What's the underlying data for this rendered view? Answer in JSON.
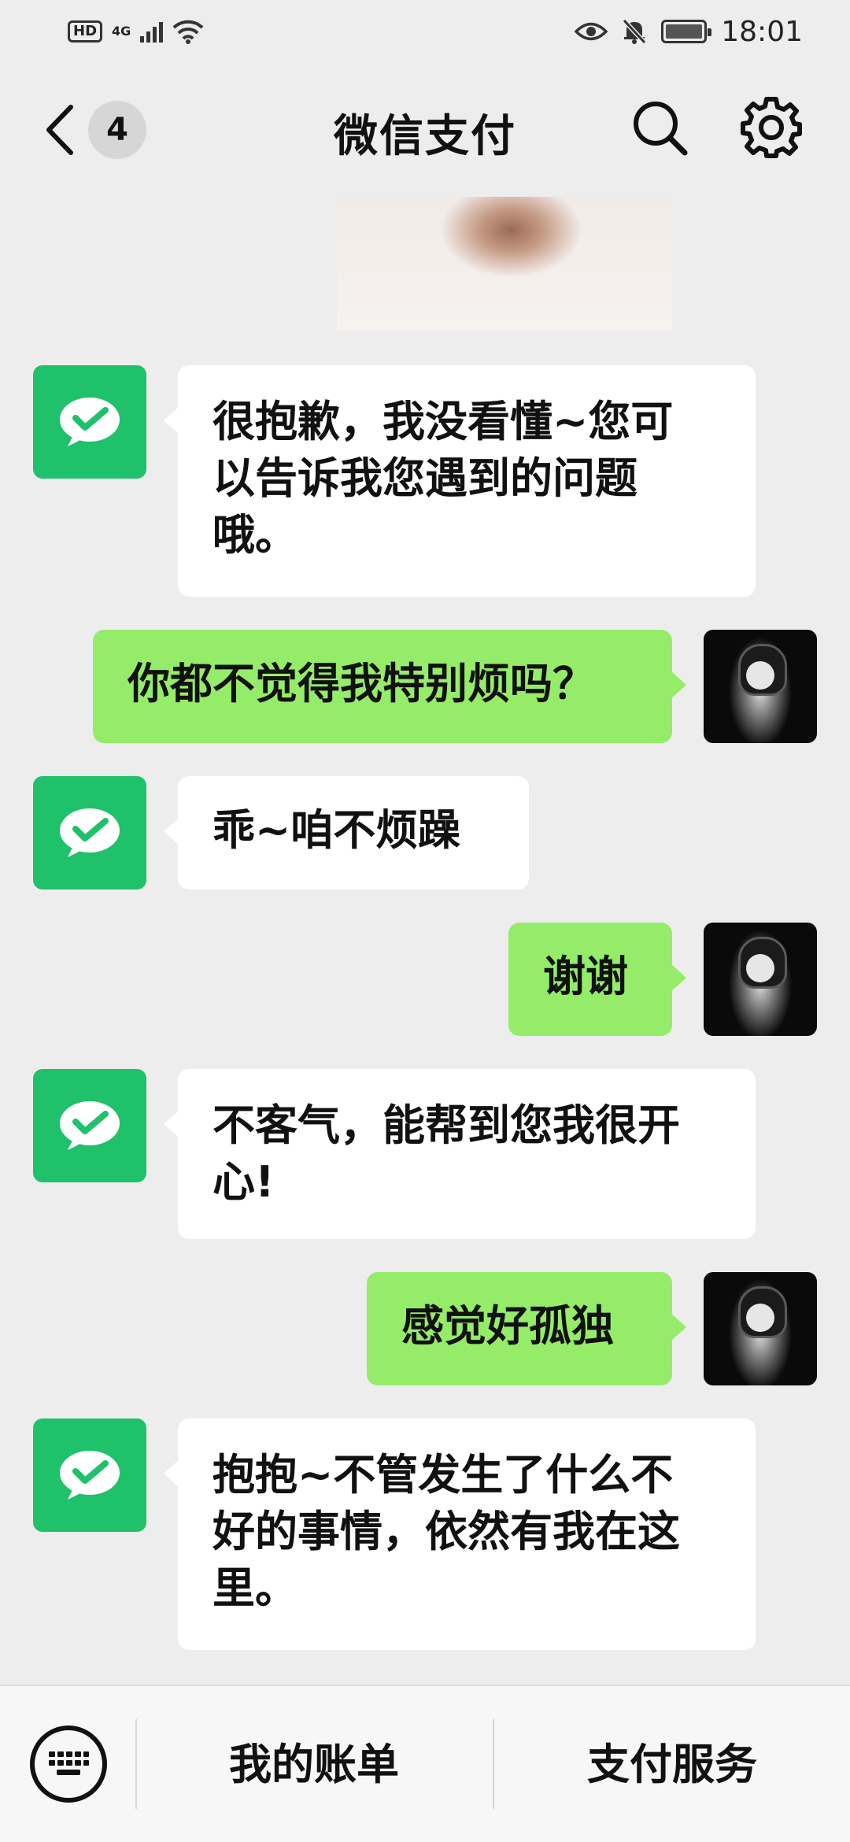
{
  "status_bar": {
    "hd": "HD",
    "network": "4G",
    "time": "18:01"
  },
  "nav": {
    "unread_count": "4",
    "title": "微信支付"
  },
  "messages": [
    {
      "from": "bot",
      "text": "很抱歉，我没看懂~您可以告诉我您遇到的问题哦。",
      "lines": [
        "很抱歉，我没看懂~您可",
        "以告诉我您遇到的问题",
        "哦。"
      ]
    },
    {
      "from": "user",
      "text": "你都不觉得我特别烦吗？"
    },
    {
      "from": "bot",
      "text": "乖~咱不烦躁",
      "lines": [
        "乖~咱不烦躁"
      ]
    },
    {
      "from": "user",
      "text": "谢谢"
    },
    {
      "from": "bot",
      "text": "不客气，能帮到您我很开心!",
      "lines": [
        "不客气，能帮到您我很开",
        "心!"
      ]
    },
    {
      "from": "user",
      "text": "感觉好孤独"
    },
    {
      "from": "bot",
      "text": "抱抱~不管发生了什么不好的事情，依然有我在这里。",
      "lines": [
        "抱抱~不管发生了什么不",
        "好的事情，依然有我在这",
        "里。"
      ]
    }
  ],
  "bottom_menu": {
    "bill": "我的账单",
    "service": "支付服务"
  },
  "colors": {
    "background": "#ededed",
    "user_bubble": "#95ec69",
    "bot_bubble": "#ffffff",
    "bot_avatar": "#1fc16b"
  },
  "icons": [
    "back-chevron-icon",
    "search-icon",
    "gear-icon",
    "wechat-pay-icon",
    "keyboard-icon",
    "eye-icon",
    "bell-off-icon",
    "battery-icon",
    "wifi-icon"
  ]
}
